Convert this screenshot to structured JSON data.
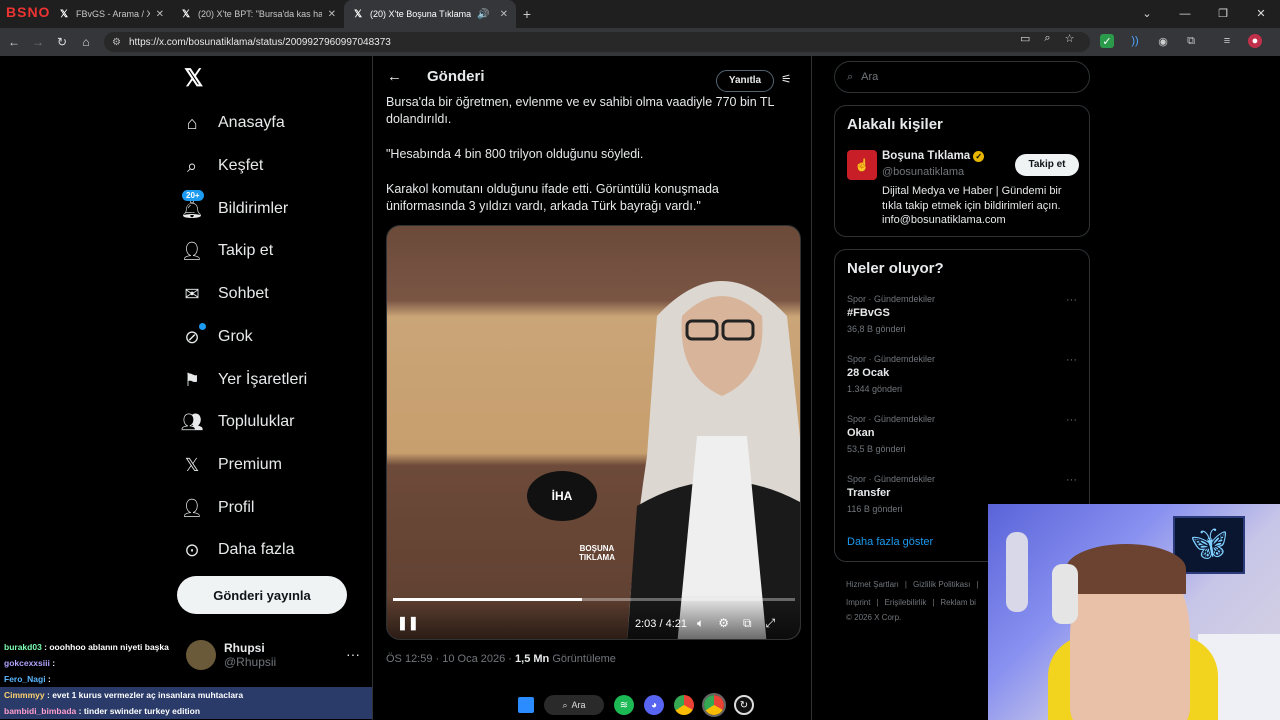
{
  "browser": {
    "streamer_logo": "BSNO",
    "tabs": [
      {
        "title": "FBvGS - Arama / X",
        "icon": "x-logo"
      },
      {
        "title": "(20) X'te BPT: \"Bursa'da kas has\"",
        "icon": "x-logo"
      },
      {
        "title": "(20) X'te Boşuna Tıklama: \"B",
        "icon": "x-logo",
        "active": true
      }
    ],
    "url": "https://x.com/bosunatiklama/status/2009927960997048373"
  },
  "nav": {
    "items": [
      {
        "label": "Anasayfa",
        "icon": "home-icon"
      },
      {
        "label": "Keşfet",
        "icon": "search-icon"
      },
      {
        "label": "Bildirimler",
        "icon": "bell-icon",
        "badge": "20+"
      },
      {
        "label": "Takip et",
        "icon": "follow-icon"
      },
      {
        "label": "Sohbet",
        "icon": "mail-icon"
      },
      {
        "label": "Grok",
        "icon": "grok-icon"
      },
      {
        "label": "Yer İşaretleri",
        "icon": "bookmark-icon"
      },
      {
        "label": "Topluluklar",
        "icon": "communities-icon"
      },
      {
        "label": "Premium",
        "icon": "x-icon"
      },
      {
        "label": "Profil",
        "icon": "profile-icon"
      },
      {
        "label": "Daha fazla",
        "icon": "more-icon"
      }
    ],
    "post_button": "Gönderi yayınla",
    "account": {
      "name": "Rhupsi",
      "handle": "@Rhupsii"
    }
  },
  "main": {
    "title": "Gönderi",
    "reply_button": "Yanıtla",
    "post_text": [
      "Bursa'da bir öğretmen, evlenme ve ev sahibi olma vaadiyle 770 bin TL dolandırıldı.",
      "\"Hesabında 4 bin 800 trilyon olduğunu söyledi.",
      "Karakol komutanı olduğunu ifade etti. Görüntülü konuşmada üniformasında 3 yıldızı vardı, arkada Türk bayrağı vardı.\""
    ],
    "video": {
      "time": "2:03 / 4:21",
      "progress": 0.47,
      "watermark": "BOŞUNA TIKLAMA",
      "mic_logo": "İHA"
    },
    "meta": {
      "time": "ÖS 12:59 · 10 Oca 2026 · ",
      "views": "1,5 Mn",
      "views_label": " Görüntüleme"
    }
  },
  "right": {
    "search_placeholder": "Ara",
    "related": {
      "title": "Alakalı kişiler",
      "name": "Boşuna Tıklama",
      "handle": "@bosunatiklama",
      "bio": "Dijital Medya ve Haber | Gündemi bir tıkla takip etmek için bildirimleri açın. info@bosunatiklama.com",
      "follow": "Takip et"
    },
    "trends": {
      "title": "Neler oluyor?",
      "items": [
        {
          "cat": "Spor · Gündemdekiler",
          "name": "#FBvGS",
          "count": "36,8 B gönderi"
        },
        {
          "cat": "Spor · Gündemdekiler",
          "name": "28 Ocak",
          "count": "1.344 gönderi"
        },
        {
          "cat": "Spor · Gündemdekiler",
          "name": "Okan",
          "count": "53,5 B gönderi"
        },
        {
          "cat": "Spor · Gündemdekiler",
          "name": "Transfer",
          "count": "116 B gönderi"
        }
      ],
      "show_more": "Daha fazla göster"
    },
    "footer": {
      "row1": [
        "Hizmet Şartları",
        "|",
        "Gizlilik Politikası",
        "|"
      ],
      "row2": [
        "Imprint",
        "|",
        "Erişilebilirlik",
        "|",
        "Reklam bi"
      ],
      "row3": "© 2026 X Corp."
    }
  },
  "chat": [
    {
      "user": "burakd03",
      "msg": ": ooohhoo ablanın niyeti başka"
    },
    {
      "user": "gokcexxsiii",
      "msg": ":"
    },
    {
      "user": "Fero_Nagi",
      "msg": ":"
    },
    {
      "user": "Cimmmyy",
      "msg": ": evet 1 kurus vermezler aç insanlara muhtaclara"
    },
    {
      "user": "bambidi_bimbada",
      "msg": ": tinder swinder turkey edition"
    }
  ],
  "taskbar": {
    "search": "Ara"
  }
}
